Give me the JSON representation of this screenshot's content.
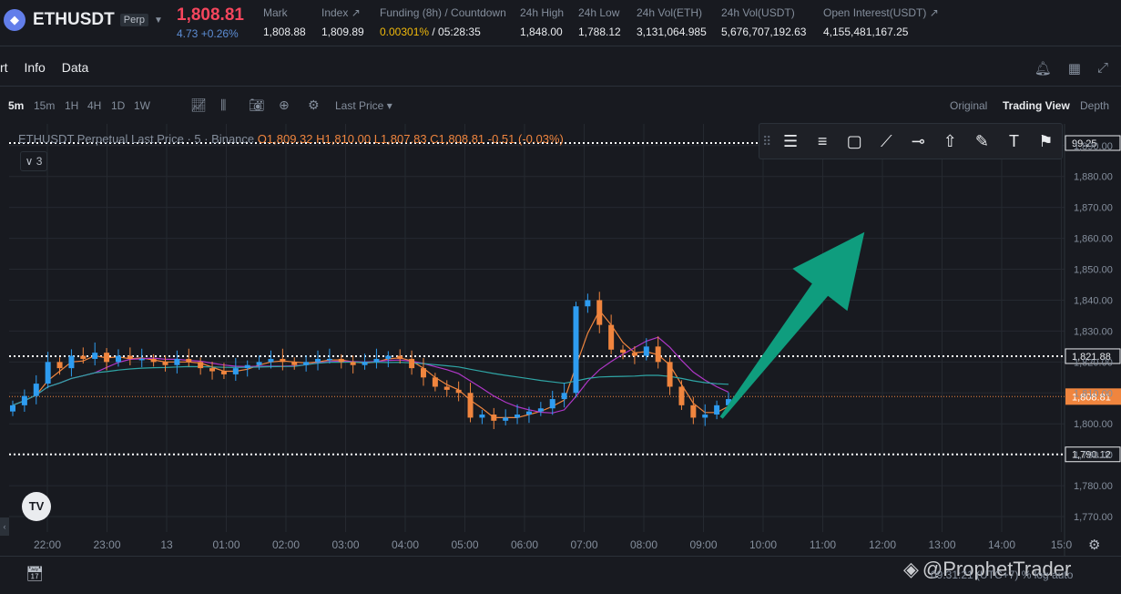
{
  "header": {
    "symbol": "ETHUSDT",
    "contract_badge": "Perp",
    "last_price": "1,808.81",
    "change": "4.73 +0.26%",
    "stats": [
      {
        "label": "Mark",
        "value": "1,808.88"
      },
      {
        "label": "Index ↗",
        "value": "1,809.89"
      },
      {
        "label": "Funding (8h) / Countdown",
        "value_highlight": "0.00301%",
        "value": " / 05:28:35"
      },
      {
        "label": "24h High",
        "value": "1,848.00"
      },
      {
        "label": "24h Low",
        "value": "1,788.12"
      },
      {
        "label": "24h Vol(ETH)",
        "value": "3,131,064.985"
      },
      {
        "label": "24h Vol(USDT)",
        "value": "5,676,707,192.63"
      },
      {
        "label": "Open Interest(USDT) ↗",
        "value": "4,155,481,167.25"
      }
    ]
  },
  "tabs": {
    "chart": "rt",
    "info": "Info",
    "data": "Data"
  },
  "toolbar": {
    "intervals": [
      "5m",
      "15m",
      "1H",
      "4H",
      "1D",
      "1W"
    ],
    "active_interval": "5m",
    "price_type": "Last Price ▾",
    "views": [
      "Original",
      "Trading View",
      "Depth"
    ],
    "active_view": "Trading View"
  },
  "legend": {
    "title": "ETHUSDT Perpetual Last Price · 5 · Binance",
    "ohlc": "O1,809.32  H1,810.00  L1,807.83  C1,808.81  -0.51 (-0.03%)",
    "collapse": "∨ 3"
  },
  "colors": {
    "up": "#2e9cf0",
    "down": "#f0853e",
    "ma_short": "#f0853e",
    "ma_mid": "#b037c8",
    "ma_long": "#2fa6a6",
    "arrow": "#0f9d7e",
    "current_price_tag": "#f0853e"
  },
  "chart_data": {
    "type": "candlestick",
    "x_ticks": [
      "22:00",
      "23:00",
      "13",
      "01:00",
      "02:00",
      "03:00",
      "04:00",
      "05:00",
      "06:00",
      "07:00",
      "08:00",
      "09:00",
      "10:00",
      "11:00",
      "12:00",
      "13:00",
      "14:00",
      "15:0"
    ],
    "y_ticks": [
      1890,
      1880,
      1870,
      1860,
      1850,
      1840,
      1830,
      1820,
      1810,
      1800,
      1790,
      1780,
      1770
    ],
    "y_tick_labels": [
      "1,890.00",
      "1,880.00",
      "1,870.00",
      "1,860.00",
      "1,850.00",
      "1,840.00",
      "1,830.00",
      "1,820.00",
      "1,810.00",
      "1,800.00",
      "1,790.00",
      "1,780.00",
      "1,770.00"
    ],
    "ylim": [
      1765,
      1897
    ],
    "horizontal_lines": [
      {
        "price": 1899.25,
        "label": "99.25"
      },
      {
        "price": 1821.88,
        "label": "1,821.88"
      },
      {
        "price": 1790.12,
        "label": "1,790.12"
      }
    ],
    "current_price": {
      "price": 1808.81,
      "label": "1,808.81"
    },
    "candles_close": [
      1806,
      1809,
      1813,
      1820,
      1818,
      1822,
      1821,
      1823,
      1820,
      1822,
      1821,
      1821,
      1820,
      1819,
      1821,
      1820,
      1818,
      1817,
      1816,
      1818,
      1819,
      1820,
      1821,
      1820,
      1819,
      1820,
      1821,
      1821,
      1820,
      1819,
      1820,
      1821,
      1822,
      1821,
      1818,
      1815,
      1812,
      1811,
      1810,
      1802,
      1803,
      1801,
      1802,
      1803,
      1804,
      1805,
      1808,
      1810,
      1838,
      1840,
      1832,
      1824,
      1823,
      1822,
      1825,
      1820,
      1812,
      1806,
      1802,
      1803,
      1806,
      1808
    ],
    "arrow": {
      "from_time_index": 11.3,
      "from_price": 1802,
      "to_time_index": 13.7,
      "to_price": 1862
    }
  },
  "drawing_tools": [
    "horizontal-ray-icon",
    "parallel-lines-icon",
    "rectangle-icon",
    "trend-line-icon",
    "price-line-icon",
    "arrow-up-icon",
    "pen-icon",
    "text-icon",
    "flag-icon"
  ],
  "bottom": {
    "watermark": "@ProphetTrader",
    "status": "09:31:21 (UTC+7)   %   log   auto"
  }
}
